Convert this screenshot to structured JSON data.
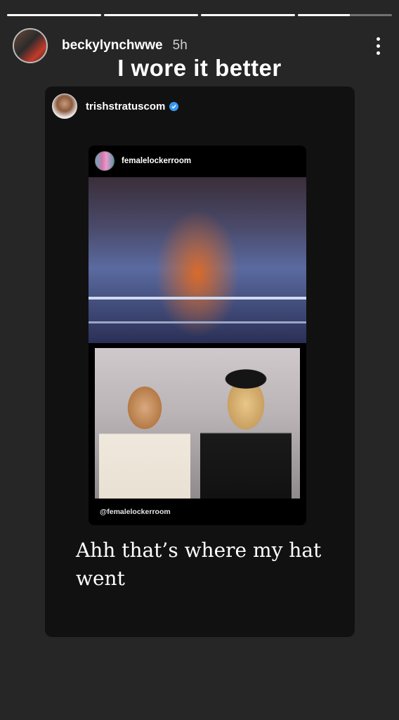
{
  "story": {
    "progress": [
      1,
      1,
      1,
      0.55
    ],
    "author": {
      "username": "beckylynchwwe",
      "time": "5h"
    },
    "caption": "I wore it better",
    "menu_icon": "more-vertical-icon"
  },
  "shared_post": {
    "username": "trishstratuscom",
    "verified_icon": "verified-badge-icon",
    "inner_post": {
      "username": "femalelockerroom",
      "watermark": "@femalelockerroom"
    },
    "text": "Ahh that’s where my hat went"
  },
  "colors": {
    "background": "#262626",
    "card": "#111111",
    "verified": "#3897f0"
  }
}
